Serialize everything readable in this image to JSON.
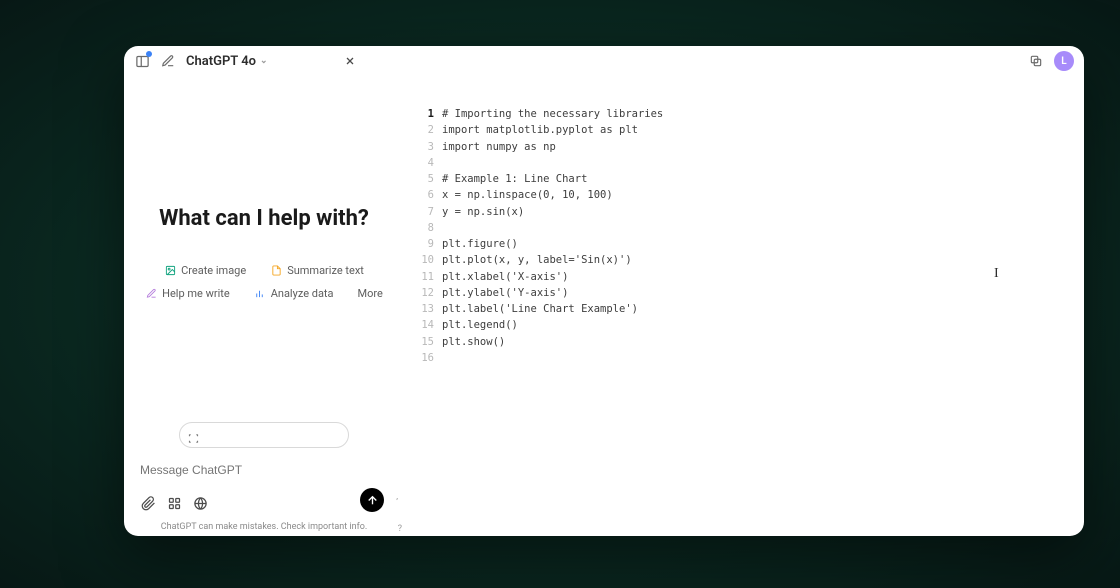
{
  "header": {
    "title": "ChatGPT 4o",
    "avatar_initial": "L"
  },
  "chat": {
    "heading": "What can I help with?",
    "input_placeholder": "Message ChatGPT",
    "disclaimer": "ChatGPT can make mistakes. Check important info."
  },
  "suggestions": [
    {
      "label": "Create image"
    },
    {
      "label": "Summarize text"
    },
    {
      "label": "Help me write"
    },
    {
      "label": "Analyze data"
    },
    {
      "label": "More"
    }
  ],
  "code": {
    "line_count": 16,
    "active_line": 1,
    "lines": [
      "# Importing the necessary libraries",
      "import matplotlib.pyplot as plt",
      "import numpy as np",
      "",
      "# Example 1: Line Chart",
      "x = np.linspace(0, 10, 100)",
      "y = np.sin(x)",
      "",
      "plt.figure()",
      "plt.plot(x, y, label='Sin(x)')",
      "plt.xlabel('X-axis')",
      "plt.ylabel('Y-axis')",
      "plt.label('Line Chart Example')",
      "plt.legend()",
      "plt.show()",
      ""
    ]
  }
}
